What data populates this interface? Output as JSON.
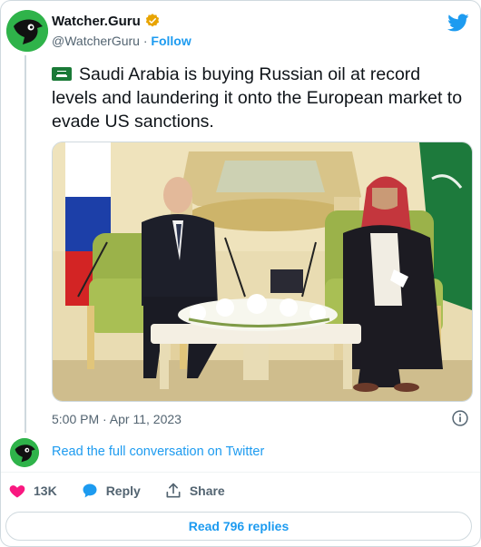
{
  "author": {
    "display_name": "Watcher.Guru",
    "handle": "@WatcherGuru",
    "separator": "·",
    "follow_label": "Follow",
    "verified": true,
    "brand_color": "#2fb34a"
  },
  "tweet": {
    "text": "Saudi Arabia is buying Russian oil at record levels and laundering it onto the European market to evade US sanctions.",
    "flag_icon": "saudi-flag-icon",
    "timestamp": "5:00 PM · Apr 11, 2023"
  },
  "conversation": {
    "read_full_label": "Read the full conversation on Twitter"
  },
  "actions": {
    "like_count": "13K",
    "reply_label": "Reply",
    "share_label": "Share",
    "like_color": "#f91880",
    "reply_color": "#1d9bf0"
  },
  "replies": {
    "read_replies_label": "Read 796 replies"
  },
  "colors": {
    "accent": "#1d9bf0",
    "muted": "#536471",
    "border": "#cfd9de"
  }
}
